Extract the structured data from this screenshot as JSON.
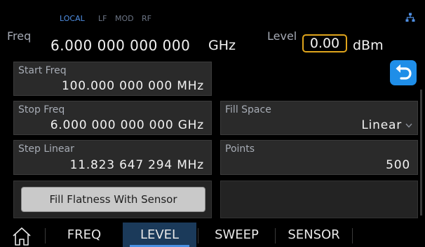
{
  "status": {
    "local": "LOCAL",
    "lf": "LF",
    "mod": "MOD",
    "rf": "RF",
    "net_icon": "network-icon"
  },
  "header": {
    "freq_label": "Freq",
    "freq_value": "6.000 000 000 000",
    "freq_unit": "GHz",
    "level_label": "Level",
    "level_value": "0.00",
    "level_unit": "dBm"
  },
  "fields": {
    "start_freq": {
      "label": "Start Freq",
      "value": "100.000 000 000 MHz"
    },
    "stop_freq": {
      "label": "Stop Freq",
      "value": "6.000 000 000 000 GHz"
    },
    "step_linear": {
      "label": "Step Linear",
      "value": "11.823 647 294 MHz"
    },
    "fill_space": {
      "label": "Fill Space",
      "value": "Linear",
      "icon": "chevron-down-icon"
    },
    "points": {
      "label": "Points",
      "value": "500"
    }
  },
  "buttons": {
    "fill_flatness": "Fill Flatness With Sensor",
    "back_icon": "back-arrow-icon"
  },
  "tabs": [
    {
      "label": "FREQ",
      "active": false
    },
    {
      "label": "LEVEL",
      "active": true
    },
    {
      "label": "SWEEP",
      "active": false
    },
    {
      "label": "SENSOR",
      "active": false
    }
  ],
  "colors": {
    "accent_blue": "#1f8ee8",
    "highlight_orange": "#e0a51c",
    "status_blue": "#4f8fe3"
  }
}
